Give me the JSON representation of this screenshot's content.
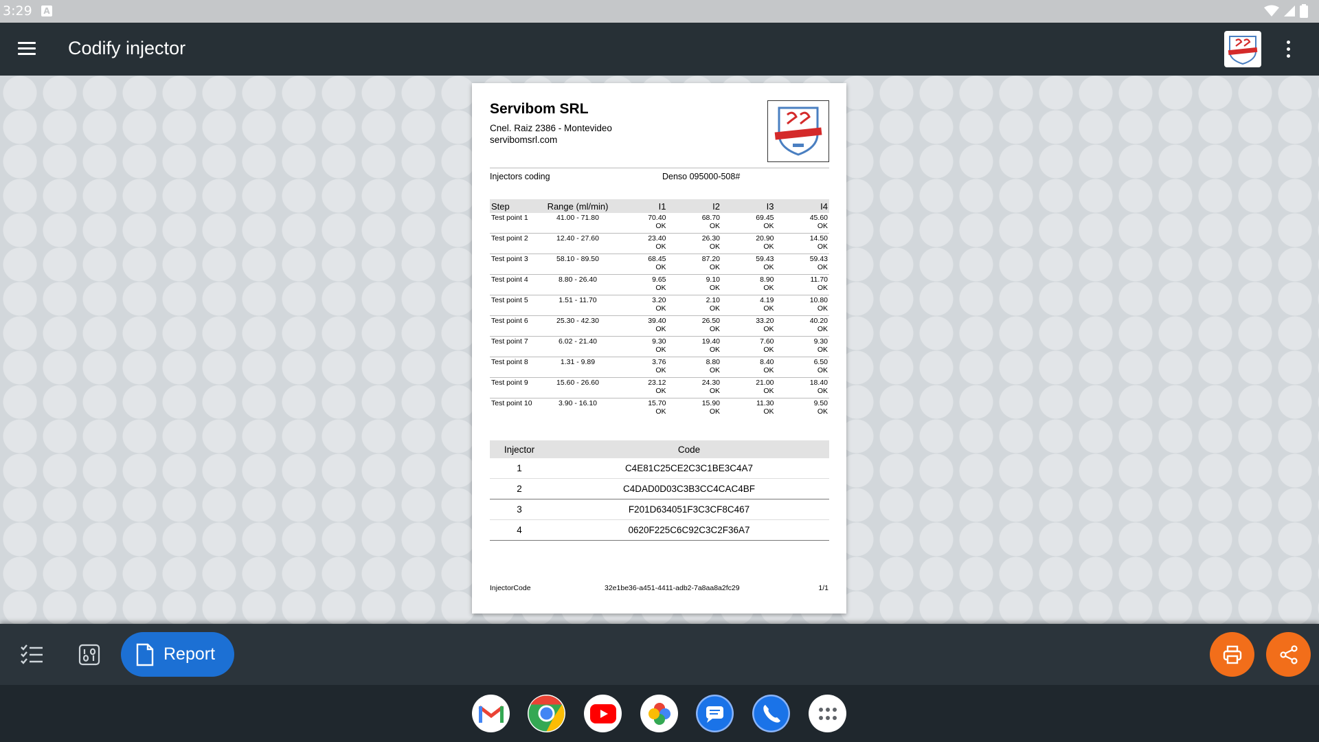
{
  "status_bar": {
    "time": "3:29",
    "notification_badge": "A"
  },
  "app_bar": {
    "title": "Codify injector",
    "logo_icon": "servibom-logo-icon"
  },
  "document": {
    "company": "Servibom SRL",
    "address": "Cnel. Raiz 2386 - Montevideo",
    "website": "servibomsrl.com",
    "doc_type": "Injectors coding",
    "model": "Denso 095000-508#",
    "table_headers": {
      "step": "Step",
      "range": "Range (ml/min)",
      "i1": "I1",
      "i2": "I2",
      "i3": "I3",
      "i4": "I4"
    },
    "rows": [
      {
        "step": "Test point 1",
        "range": "41.00 - 71.80",
        "v": [
          "70.40",
          "68.70",
          "69.45",
          "45.60"
        ],
        "s": [
          "OK",
          "OK",
          "OK",
          "OK"
        ]
      },
      {
        "step": "Test point 2",
        "range": "12.40 - 27.60",
        "v": [
          "23.40",
          "26.30",
          "20.90",
          "14.50"
        ],
        "s": [
          "OK",
          "OK",
          "OK",
          "OK"
        ]
      },
      {
        "step": "Test point 3",
        "range": "58.10 - 89.50",
        "v": [
          "68.45",
          "87.20",
          "59.43",
          "59.43"
        ],
        "s": [
          "OK",
          "OK",
          "OK",
          "OK"
        ]
      },
      {
        "step": "Test point 4",
        "range": "8.80 - 26.40",
        "v": [
          "9.65",
          "9.10",
          "8.90",
          "11.70"
        ],
        "s": [
          "OK",
          "OK",
          "OK",
          "OK"
        ]
      },
      {
        "step": "Test point 5",
        "range": "1.51 - 11.70",
        "v": [
          "3.20",
          "2.10",
          "4.19",
          "10.80"
        ],
        "s": [
          "OK",
          "OK",
          "OK",
          "OK"
        ]
      },
      {
        "step": "Test point 6",
        "range": "25.30 - 42.30",
        "v": [
          "39.40",
          "26.50",
          "33.20",
          "40.20"
        ],
        "s": [
          "OK",
          "OK",
          "OK",
          "OK"
        ]
      },
      {
        "step": "Test point 7",
        "range": "6.02 - 21.40",
        "v": [
          "9.30",
          "19.40",
          "7.60",
          "9.30"
        ],
        "s": [
          "OK",
          "OK",
          "OK",
          "OK"
        ]
      },
      {
        "step": "Test point 8",
        "range": "1.31 - 9.89",
        "v": [
          "3.76",
          "8.80",
          "8.40",
          "6.50"
        ],
        "s": [
          "OK",
          "OK",
          "OK",
          "OK"
        ]
      },
      {
        "step": "Test point 9",
        "range": "15.60 - 26.60",
        "v": [
          "23.12",
          "24.30",
          "21.00",
          "18.40"
        ],
        "s": [
          "OK",
          "OK",
          "OK",
          "OK"
        ]
      },
      {
        "step": "Test point 10",
        "range": "3.90 - 16.10",
        "v": [
          "15.70",
          "15.90",
          "11.30",
          "9.50"
        ],
        "s": [
          "OK",
          "OK",
          "OK",
          "OK"
        ]
      }
    ],
    "codes_headers": {
      "injector": "Injector",
      "code": "Code"
    },
    "codes": [
      {
        "injector": "1",
        "code": "C4E81C25CE2C3C1BE3C4A7"
      },
      {
        "injector": "2",
        "code": "C4DAD0D03C3B3CC4CAC4BF"
      },
      {
        "injector": "3",
        "code": "F201D634051F3C3CF8C467"
      },
      {
        "injector": "4",
        "code": "0620F225C6C92C3C2F36A7"
      }
    ],
    "footer": {
      "left": "InjectorCode",
      "center": "32e1be36-a451-4411-adb2-7a8aa8a2fc29",
      "right": "1/1"
    }
  },
  "bottom_bar": {
    "report_label": "Report"
  },
  "colors": {
    "appbar": "#273036",
    "workspace": "#d2d7db",
    "report_button": "#1c70d4",
    "fab": "#f26e1a",
    "dock": "#1f272d"
  },
  "icons": [
    "menu-icon",
    "more-vert-icon",
    "checklist-icon",
    "binary-icon",
    "document-icon",
    "print-icon",
    "share-icon",
    "gmail-icon",
    "chrome-icon",
    "youtube-icon",
    "photos-icon",
    "messages-icon",
    "phone-icon",
    "app-drawer-icon"
  ]
}
